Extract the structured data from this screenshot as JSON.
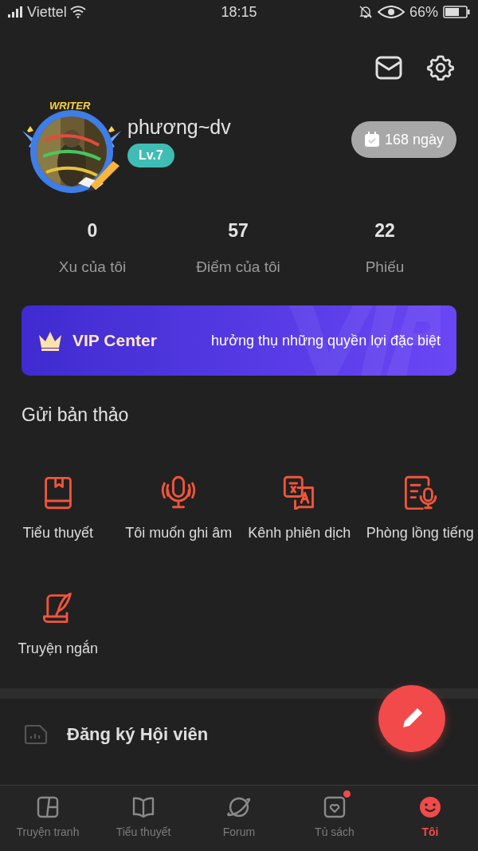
{
  "status_bar": {
    "carrier": "Viettel",
    "time": "18:15",
    "battery": "66%"
  },
  "profile": {
    "badge": "WRITER",
    "username": "phương~dv",
    "level": "Lv.7",
    "streak": "168 ngày"
  },
  "stats": [
    {
      "value": "0",
      "label": "Xu của tôi"
    },
    {
      "value": "57",
      "label": "Điểm của tôi"
    },
    {
      "value": "22",
      "label": "Phiếu"
    }
  ],
  "vip_banner": {
    "title": "VIP Center",
    "subtitle": "hưởng thụ những quyền lợi đặc biệt"
  },
  "submit_section": {
    "title": "Gửi bản thảo",
    "items": [
      {
        "kind": "book",
        "label": "Tiểu thuyết"
      },
      {
        "kind": "mic",
        "label": "Tôi muốn ghi âm"
      },
      {
        "kind": "translate",
        "label": "Kênh phiên dịch"
      },
      {
        "kind": "dubbing",
        "label": "Phòng lồng tiếng"
      },
      {
        "kind": "quill",
        "label": "Truyện ngắn"
      }
    ]
  },
  "menu": [
    {
      "label": "Đăng ký Hội viên"
    }
  ],
  "bottom_nav": [
    {
      "kind": "comic",
      "label": "Truyện tranh",
      "selected": false,
      "badge": false
    },
    {
      "kind": "book",
      "label": "Tiểu thuyết",
      "selected": false,
      "badge": false
    },
    {
      "kind": "planet",
      "label": "Forum",
      "selected": false,
      "badge": false
    },
    {
      "kind": "shelf",
      "label": "Tủ sách",
      "selected": false,
      "badge": true
    },
    {
      "kind": "smile",
      "label": "Tôi",
      "selected": true,
      "badge": false
    }
  ]
}
